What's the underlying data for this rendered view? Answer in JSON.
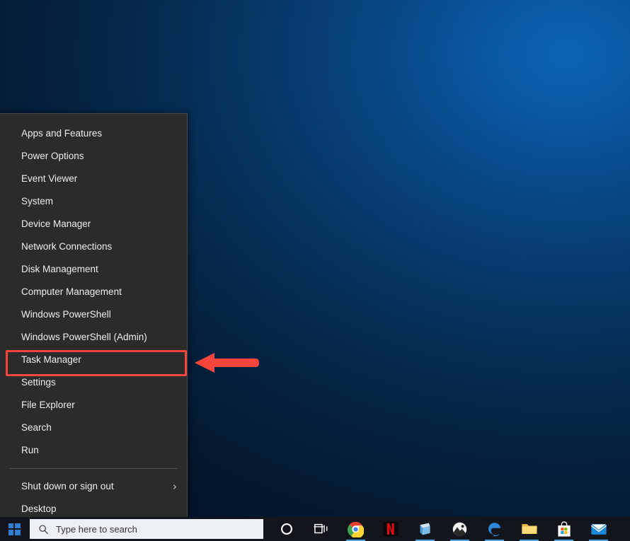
{
  "desktop": {
    "background_colors": {
      "highlight": "#0b63b3",
      "mid": "#06305a",
      "shadow": "#021428"
    }
  },
  "winx_menu": {
    "name": "Win+X Power User Menu",
    "highlighted_item": "Task Manager",
    "highlight_color": "#f5453c",
    "background_color": "#2b2b2b",
    "items": [
      {
        "label": "Apps and Features",
        "has_submenu": false
      },
      {
        "label": "Power Options",
        "has_submenu": false
      },
      {
        "label": "Event Viewer",
        "has_submenu": false
      },
      {
        "label": "System",
        "has_submenu": false
      },
      {
        "label": "Device Manager",
        "has_submenu": false
      },
      {
        "label": "Network Connections",
        "has_submenu": false
      },
      {
        "label": "Disk Management",
        "has_submenu": false
      },
      {
        "label": "Computer Management",
        "has_submenu": false
      },
      {
        "label": "Windows PowerShell",
        "has_submenu": false
      },
      {
        "label": "Windows PowerShell (Admin)",
        "has_submenu": false
      },
      {
        "label": "Task Manager",
        "has_submenu": false
      },
      {
        "label": "Settings",
        "has_submenu": false
      },
      {
        "label": "File Explorer",
        "has_submenu": false
      },
      {
        "label": "Search",
        "has_submenu": false
      },
      {
        "label": "Run",
        "has_submenu": false
      }
    ],
    "footer_items": [
      {
        "label": "Shut down or sign out",
        "has_submenu": true,
        "chevron": "›"
      },
      {
        "label": "Desktop",
        "has_submenu": false
      }
    ]
  },
  "annotation": {
    "arrow_color": "#f5453c",
    "arrow_direction": "left",
    "points_at": "Task Manager"
  },
  "taskbar": {
    "background_color": "#12151c",
    "start_button": {
      "label": "Start",
      "icon": "windows-logo-icon"
    },
    "search": {
      "placeholder": "Type here to search",
      "value": "",
      "icon": "search-icon"
    },
    "icons": [
      {
        "name": "cortana-icon",
        "label": "Cortana",
        "active": false
      },
      {
        "name": "task-view-icon",
        "label": "Task View",
        "active": false
      },
      {
        "name": "chrome-icon",
        "label": "Google Chrome",
        "active": true
      },
      {
        "name": "netflix-icon",
        "label": "Netflix",
        "active": false
      },
      {
        "name": "store-blue-icon",
        "label": "Microsoft Office",
        "active": true
      },
      {
        "name": "photos-icon",
        "label": "Photos",
        "active": true
      },
      {
        "name": "edge-icon",
        "label": "Microsoft Edge",
        "active": true
      },
      {
        "name": "file-explorer-icon",
        "label": "File Explorer",
        "active": true
      },
      {
        "name": "microsoft-store-icon",
        "label": "Microsoft Store",
        "active": true
      },
      {
        "name": "mail-icon",
        "label": "Mail",
        "active": true
      }
    ]
  }
}
